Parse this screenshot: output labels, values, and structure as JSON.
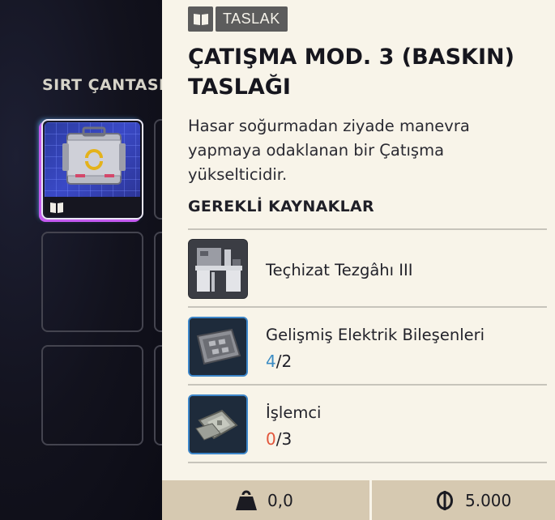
{
  "backpack": {
    "title": "SIRT ÇANTASI"
  },
  "item": {
    "type_tag": "TASLAK",
    "title": "ÇATIŞMA MOD. 3 (BASKIN) TASLAĞI",
    "description": "Hasar soğurmadan ziyade manevra yapmaya odaklanan bir Çatışma yükselticidir.",
    "resources_header": "GEREKLİ KAYNAKLAR",
    "resources": [
      {
        "name": "Teçhizat Tezgâhı III",
        "icon": "workbench-icon"
      },
      {
        "name": "Gelişmiş Elektrik Bileşenleri",
        "have": "4",
        "sep": "/",
        "need": "2",
        "icon": "electrical-components-icon"
      },
      {
        "name": "İşlemci",
        "have": "0",
        "sep": "/",
        "need": "3",
        "icon": "processor-icon"
      }
    ]
  },
  "stats": {
    "weight": "0,0",
    "value": "5.000",
    "weight_icon": "weight-icon",
    "currency_icon": "coin-icon"
  },
  "colors": {
    "panel_bg": "#f8f4e9",
    "have_ok": "#3b8cc4",
    "have_missing": "#e2553b",
    "bottom_bar": "#d6c9b1"
  }
}
